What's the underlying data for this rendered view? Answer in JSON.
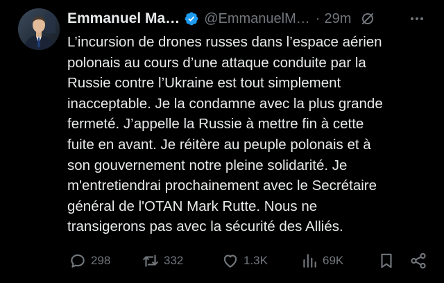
{
  "header": {
    "display_name": "Emmanuel Ma…",
    "handle": "@EmmanuelM…",
    "separator": "·",
    "time": "29m",
    "verified_icon": "verified-badge-icon",
    "colors": {
      "verified": "#1d9bf0",
      "muted": "#71767b",
      "text": "#e7e9ea",
      "background": "#000000"
    }
  },
  "tweet": {
    "text": "L’incursion de drones russes dans l’espace aérien\npolonais au cours d’une attaque conduite par la\nRussie contre l’Ukraine est tout simplement\ninacceptable. Je la condamne avec la plus grande\nfermeté. J’appelle la Russie à mettre fin à cette\nfuite en avant. Je réitère au peuple polonais et à\nson gouvernement notre pleine solidarité. Je\nm'entretiendrai prochainement avec le Secrétaire\ngénéral de l'OTAN Mark Rutte. Nous ne\ntransigerons pas avec la sécurité des Alliés."
  },
  "actions": {
    "replies": "298",
    "reposts": "332",
    "likes": "1.3K",
    "views": "69K"
  }
}
